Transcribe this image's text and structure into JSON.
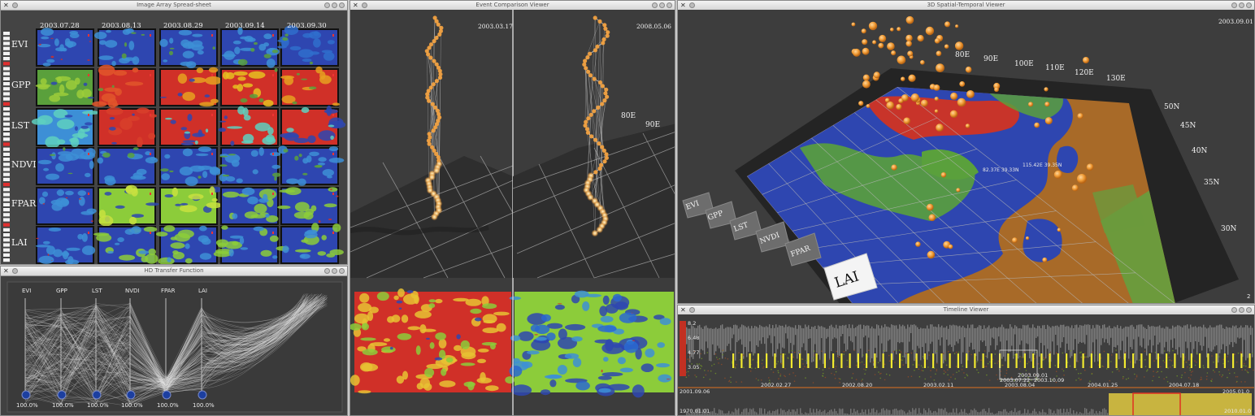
{
  "windows": {
    "spreadsheet": {
      "title": "Image Array Spread-sheet",
      "dates": [
        "2003.07.28",
        "2003.08.13",
        "2003.08.29",
        "2003.09.14",
        "2003.09.30"
      ],
      "variables": [
        "EVI",
        "GPP",
        "LST",
        "NDVI",
        "FPAR",
        "LAI"
      ]
    },
    "transfer": {
      "title": "HD Transfer Function",
      "axes": [
        "EVI",
        "GPP",
        "LST",
        "NVDI",
        "FPAR",
        "LAI"
      ],
      "percent": "100.0%"
    },
    "comparison": {
      "title": "Event Comparison Viewer",
      "date_left": "2003.03.17",
      "date_right": "2008.05.06",
      "lon_labels": [
        "80E",
        "90E"
      ]
    },
    "spatial": {
      "title": "3D Spatial-Temporal Viewer",
      "date": "2003.09.01",
      "lon_labels": [
        "80E",
        "90E",
        "100E",
        "110E",
        "120E",
        "130E"
      ],
      "lat_labels": [
        "50N",
        "45N",
        "40N",
        "35N",
        "30N"
      ],
      "layer_tabs": [
        "EVI",
        "GPP",
        "LST",
        "NVDI",
        "FPAR"
      ],
      "active_layer": "LAI",
      "coord_a": "82.37E 39.33N",
      "coord_b": "115.42E 39.35N",
      "corner_number": "2"
    },
    "timeline": {
      "title": "Timeline Viewer",
      "y_ticks": [
        "8.2",
        "6.48",
        "4.77",
        "3.05"
      ],
      "x_dates": [
        "2002.02.27",
        "2002.08.20",
        "2003.02.11",
        "2003.08.04",
        "2004.01.25",
        "2004.07.18"
      ],
      "start_date": "2001.09.06",
      "end_date": "2005.01.0",
      "mini_start": "1970.01.01",
      "mini_end": "2010.01.0",
      "callout_1": "2003.09.01",
      "callout_2": "2003.07.22",
      "callout_3": "2003.10.09"
    }
  },
  "colors": {
    "window_bg": "#3f3f3f",
    "titlebar": "#e4e4e4",
    "event_orange": "#f0a040",
    "timeline_yellow": "#f2ea30",
    "land_brown": "#a86a28",
    "map_blue": "#2e46b0",
    "map_green": "#5aa03c",
    "map_red": "#d03028",
    "selection_red": "#e03020"
  }
}
